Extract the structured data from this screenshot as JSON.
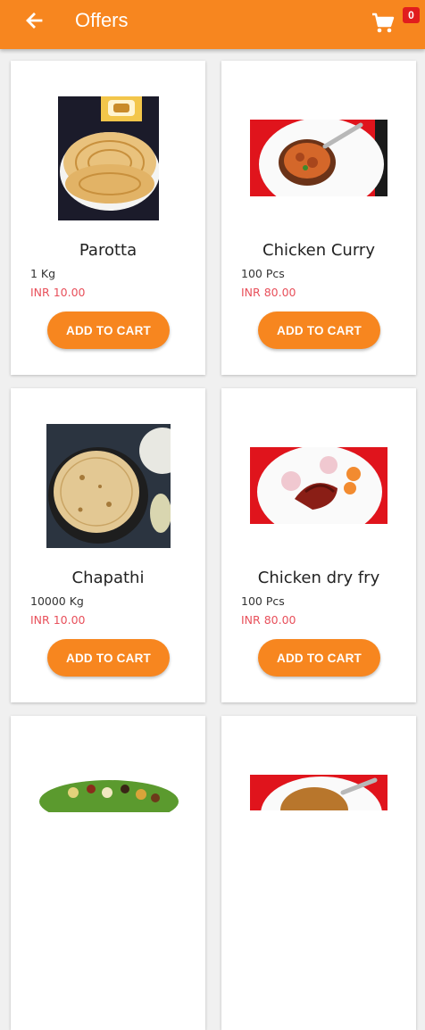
{
  "header": {
    "title": "Offers",
    "back_icon": "arrow-left-icon",
    "cart_icon": "shopping-cart-icon",
    "cart_count": "0"
  },
  "colors": {
    "accent": "#f7861f",
    "price": "#e8505b",
    "badge": "#e11d1d"
  },
  "products": [
    {
      "name": "Parotta",
      "qty": "1 Kg",
      "price": "INR 10.00",
      "button": "ADD TO CART"
    },
    {
      "name": "Chicken Curry",
      "qty": "100 Pcs",
      "price": "INR 80.00",
      "button": "ADD TO CART"
    },
    {
      "name": "Chapathi",
      "qty": "10000 Kg",
      "price": "INR 10.00",
      "button": "ADD TO CART"
    },
    {
      "name": "Chicken dry fry",
      "qty": "100 Pcs",
      "price": "INR 80.00",
      "button": "ADD TO CART"
    }
  ]
}
